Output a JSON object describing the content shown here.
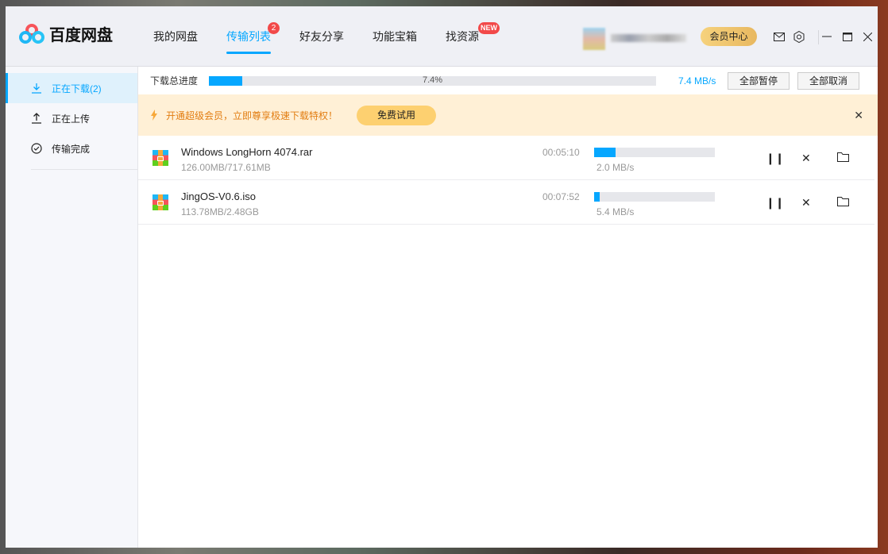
{
  "app": {
    "title": "百度网盘"
  },
  "nav": [
    {
      "label": "我的网盘"
    },
    {
      "label": "传输列表",
      "badge": "2"
    },
    {
      "label": "好友分享"
    },
    {
      "label": "功能宝箱"
    },
    {
      "label": "找资源",
      "badge": "NEW"
    }
  ],
  "header": {
    "vip_label": "会员中心"
  },
  "sidebar": {
    "items": [
      {
        "label": "正在下载(2)"
      },
      {
        "label": "正在上传"
      },
      {
        "label": "传输完成"
      }
    ]
  },
  "total": {
    "label": "下载总进度",
    "percent": 7.4,
    "percent_text": "7.4%",
    "speed": "7.4 MB/s",
    "pause_all": "全部暂停",
    "cancel_all": "全部取消"
  },
  "promo": {
    "text": "开通超级会员，立即尊享极速下载特权！",
    "button": "免费试用"
  },
  "downloads": [
    {
      "name": "Windows LongHorn 4074.rar",
      "size": "126.00MB/717.61MB",
      "time": "00:05:10",
      "progress": 17.6,
      "speed": "2.0 MB/s"
    },
    {
      "name": "JingOS-V0.6.iso",
      "size": "113.78MB/2.48GB",
      "time": "00:07:52",
      "progress": 4.6,
      "speed": "5.4 MB/s"
    }
  ],
  "colors": {
    "accent": "#06a7ff",
    "promo_bg": "#fff0d6",
    "promo_text": "#e27d11",
    "badge": "#f24949"
  }
}
